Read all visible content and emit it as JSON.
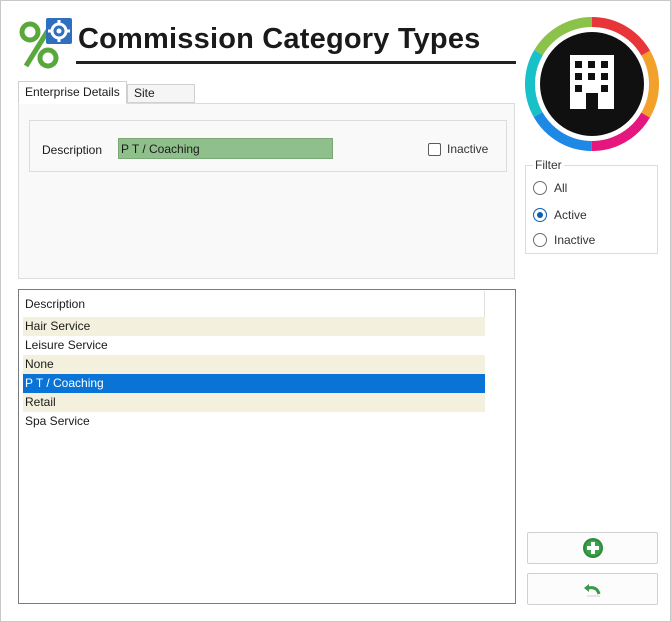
{
  "header": {
    "title": "Commission Category Types",
    "app_icon": "percent-gear-icon",
    "brand_icon": "building-icon"
  },
  "tabs": [
    {
      "label": "Enterprise Details",
      "active": true
    },
    {
      "label": "Site Details",
      "active": false
    }
  ],
  "details": {
    "description_label": "Description",
    "description_value": "P T / Coaching",
    "inactive_label": "Inactive",
    "inactive_checked": false
  },
  "list": {
    "column_header": "Description",
    "rows": [
      {
        "text": "Hair Service",
        "alt": true,
        "selected": false
      },
      {
        "text": "Leisure Service",
        "alt": false,
        "selected": false
      },
      {
        "text": "None",
        "alt": true,
        "selected": false
      },
      {
        "text": "P T / Coaching",
        "alt": false,
        "selected": true
      },
      {
        "text": "Retail",
        "alt": true,
        "selected": false
      },
      {
        "text": "Spa Service",
        "alt": false,
        "selected": false
      }
    ]
  },
  "filter": {
    "legend": "Filter",
    "options": [
      {
        "label": "All",
        "selected": false
      },
      {
        "label": "Active",
        "selected": true
      },
      {
        "label": "Inactive",
        "selected": false
      }
    ]
  },
  "buttons": {
    "add_icon": "plus-circle-icon",
    "undo_icon": "undo-arrow-icon"
  },
  "colors": {
    "accent": "#0a74d6",
    "input_bg": "#8fc08b",
    "row_alt": "#f3f1de",
    "add_green": "#2f8a3c"
  }
}
